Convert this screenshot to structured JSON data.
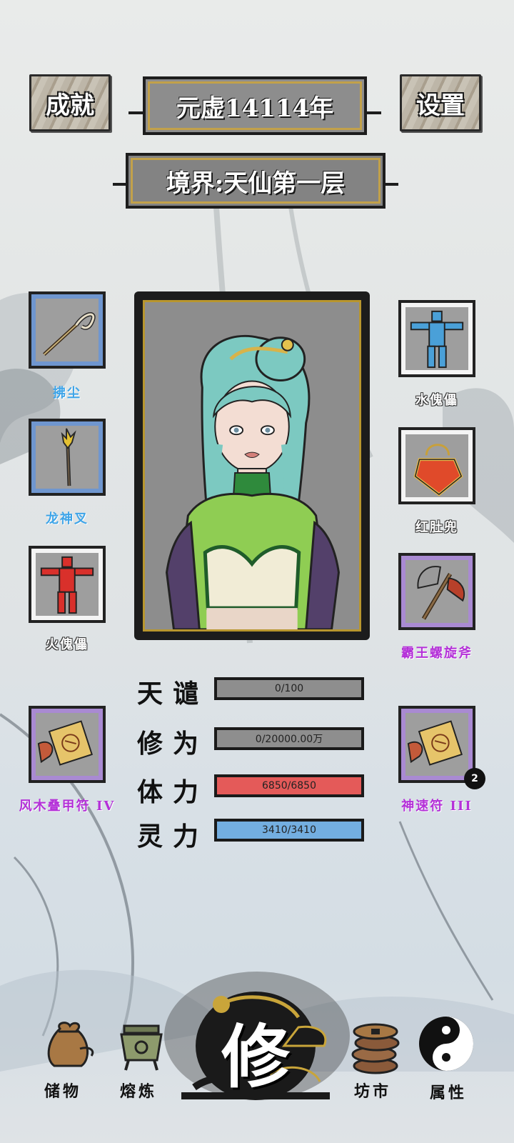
{
  "header": {
    "achievements_label": "成就",
    "year_label": "元虚14114年",
    "settings_label": "设置",
    "realm_label": "境界:天仙第一层"
  },
  "left_slots": [
    {
      "label": "拂尘",
      "icon": "whisk-icon",
      "rarity": "blue"
    },
    {
      "label": "龙神叉",
      "icon": "fork-icon",
      "rarity": "blue"
    },
    {
      "label": "火傀儡",
      "icon": "fire-puppet-icon",
      "rarity": "white"
    },
    {
      "label": "风木叠甲符 IV",
      "icon": "talisman-icon",
      "rarity": "purple"
    }
  ],
  "right_slots": [
    {
      "label": "水傀儡",
      "icon": "water-puppet-icon",
      "rarity": "white"
    },
    {
      "label": "红肚兜",
      "icon": "bib-icon",
      "rarity": "white"
    },
    {
      "label": "霸王螺旋斧",
      "icon": "axe-icon",
      "rarity": "purple"
    },
    {
      "label": "神速符 III",
      "icon": "talisman-icon",
      "rarity": "purple",
      "badge": "2"
    }
  ],
  "stats": [
    {
      "label": "天谴",
      "value": "0/100",
      "fill": 0,
      "color": "#8e8e8e"
    },
    {
      "label": "修为",
      "value": "0/20000.00万",
      "fill": 0,
      "color": "#8e8e8e"
    },
    {
      "label": "体力",
      "value": "6850/6850",
      "fill": 1,
      "color": "#e45a59"
    },
    {
      "label": "灵力",
      "value": "3410/3410",
      "fill": 1,
      "color": "#73aee0"
    }
  ],
  "nav": {
    "storage": "储物",
    "refine": "熔炼",
    "cultivate": "修",
    "market": "坊市",
    "attributes": "属性"
  },
  "colors": {
    "blue_rarity": "#6f96cf",
    "purple_rarity": "#a98ad2",
    "white_rarity": "#f4f4f4",
    "hp": "#e45a59",
    "mp": "#73aee0"
  }
}
